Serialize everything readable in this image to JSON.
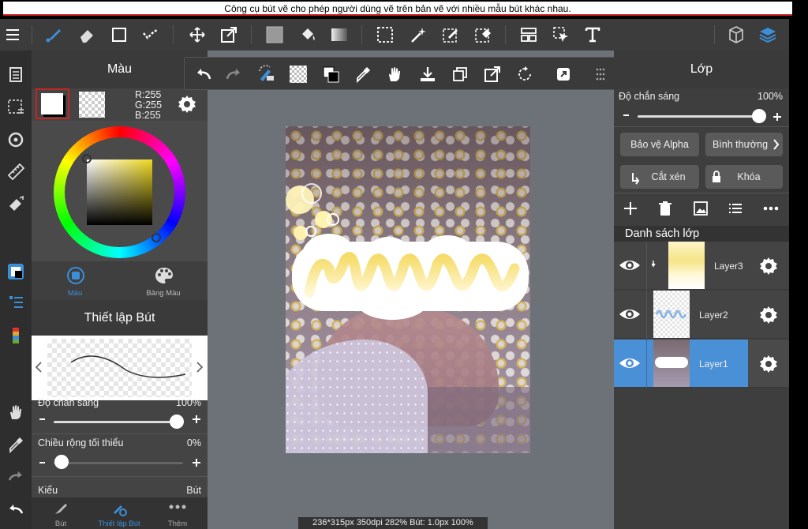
{
  "tooltip": "Công cụ bút vẽ cho phép người dùng vẽ trên bản vẽ với nhiều mẫu bút khác nhau.",
  "toolbar": {
    "icons": [
      "menu-icon",
      "brush-icon",
      "eraser-icon",
      "shape-icon",
      "line-icon",
      "move-icon",
      "transform-icon",
      "fill-color-icon",
      "bucket-icon",
      "gradient-icon",
      "selection-icon",
      "magic-wand-icon",
      "select-pen-icon",
      "select-eraser-icon",
      "layout-icon",
      "select-move-icon",
      "text-icon",
      "3d-icon",
      "layers-icon"
    ]
  },
  "color_panel": {
    "title": "Màu",
    "r": "R:255",
    "g": "G:255",
    "b": "B:255",
    "tab_color": "Màu",
    "tab_palette": "Bảng Màu"
  },
  "brush_panel": {
    "title": "Thiết lập Bút",
    "opacity_label": "Độ chắn sáng",
    "opacity_value": "100%",
    "min_width_label": "Chiều rộng tối thiểu",
    "min_width_value": "0%",
    "style_label": "Kiểu",
    "style_value": "Bút"
  },
  "bottom_tabs": {
    "brush": "Bút",
    "brush_settings": "Thiết lập Bút",
    "more": "Thêm"
  },
  "layer_panel": {
    "title": "Lớp",
    "opacity_label": "Độ chắn sáng",
    "opacity_value": "100%",
    "alpha_protect": "Bảo vệ Alpha",
    "blend_mode": "Bình thường",
    "clipping": "Cắt xén",
    "lock": "Khóa",
    "list_title": "Danh sách lớp",
    "layers": [
      {
        "name": "Layer3",
        "selected": false
      },
      {
        "name": "Layer2",
        "selected": false
      },
      {
        "name": "Layer1",
        "selected": true
      }
    ]
  },
  "status": "236*315px 350dpi 282% Bút: 1.0px 100%",
  "colors": {
    "accent": "#4a90d6",
    "background": "#6d7178"
  }
}
